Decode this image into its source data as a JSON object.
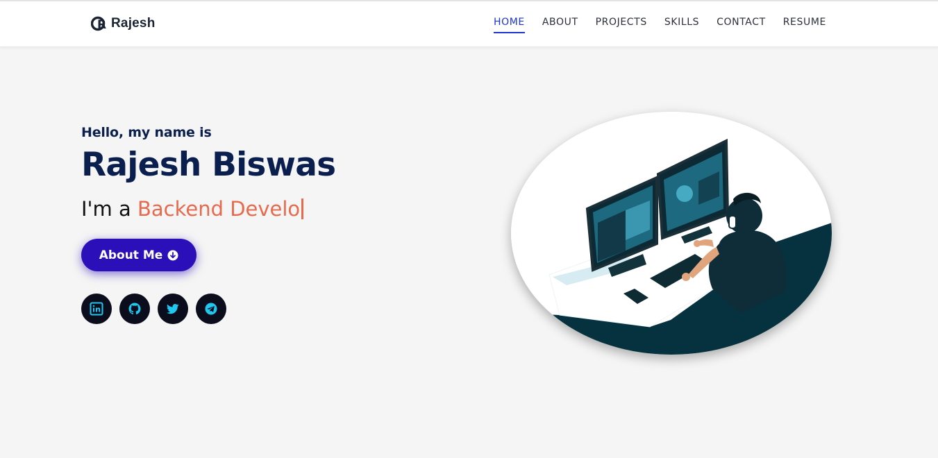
{
  "brand": {
    "name": "Rajesh",
    "logo_icon": "r-logo-icon"
  },
  "nav": {
    "items": [
      {
        "label": "HOME",
        "active": true
      },
      {
        "label": "ABOUT",
        "active": false
      },
      {
        "label": "PROJECTS",
        "active": false
      },
      {
        "label": "SKILLS",
        "active": false
      },
      {
        "label": "CONTACT",
        "active": false
      },
      {
        "label": "RESUME",
        "active": false
      }
    ]
  },
  "hero": {
    "greeting": "Hello, my name is",
    "name": "Rajesh Biswas",
    "role_prefix": "I'm a",
    "role_typed": "Backend Develo",
    "button": {
      "label": "About Me",
      "icon": "arrow-down-circle-icon"
    },
    "socials": [
      {
        "icon": "linkedin-icon"
      },
      {
        "icon": "github-icon"
      },
      {
        "icon": "twitter-icon"
      },
      {
        "icon": "telegram-icon"
      }
    ]
  },
  "colors": {
    "navy_text": "#0b1f4f",
    "accent_orange": "#e9694d",
    "button_blue": "#2b0fb8",
    "nav_active": "#1c34d4",
    "social_bg": "#0b0d1c",
    "social_icon": "#1ec8f0",
    "page_bg": "#f5f5f5"
  }
}
